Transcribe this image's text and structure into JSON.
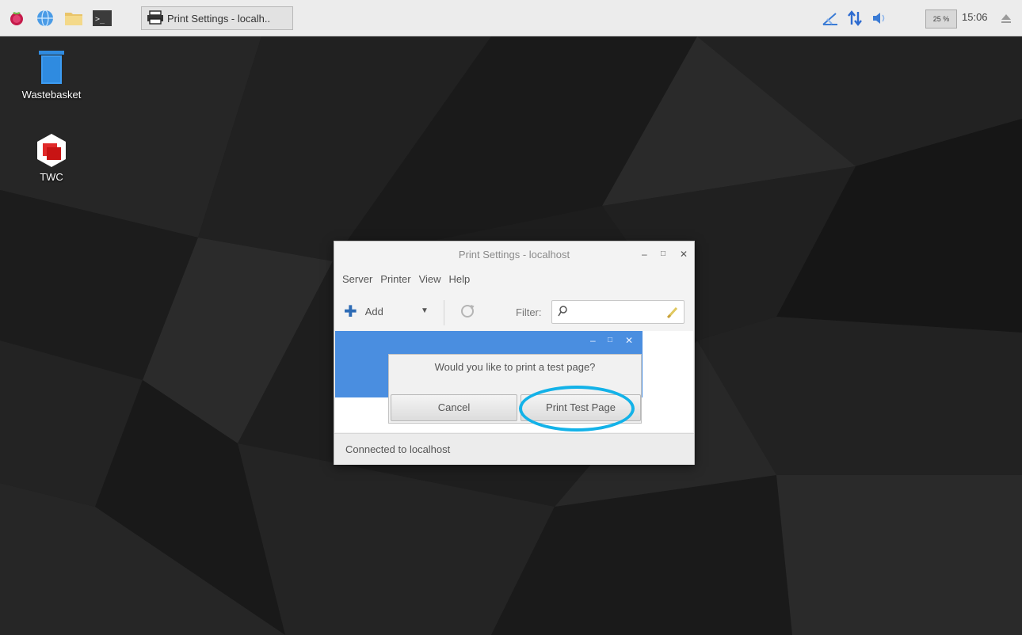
{
  "taskbar": {
    "task_button_label": "Print Settings - localh..",
    "cpu_label": "25 %",
    "clock": "15:06",
    "icons": [
      "raspberry-menu-icon",
      "web-browser-icon",
      "file-manager-icon",
      "terminal-icon"
    ],
    "tray_icons": [
      "bluetooth-icon",
      "network-icon",
      "volume-icon",
      "eject-icon"
    ]
  },
  "desktop": {
    "icons": [
      {
        "label": "Wastebasket",
        "icon": "trash-icon"
      },
      {
        "label": "TWC",
        "icon": "twc-app-icon"
      }
    ]
  },
  "print_window": {
    "title": "Print Settings - localhost",
    "menu": [
      "Server",
      "Printer",
      "View",
      "Help"
    ],
    "toolbar": {
      "add_label": "Add",
      "filter_label": "Filter:",
      "filter_value": ""
    },
    "status": "Connected to localhost"
  },
  "dialog": {
    "message": "Would you like to print a test page?",
    "cancel_label": "Cancel",
    "print_label": "Print Test Page"
  },
  "colors": {
    "accent_blue": "#4a8ee0",
    "highlight_ring": "#13b2e8",
    "taskbar_bg": "#ececec"
  }
}
